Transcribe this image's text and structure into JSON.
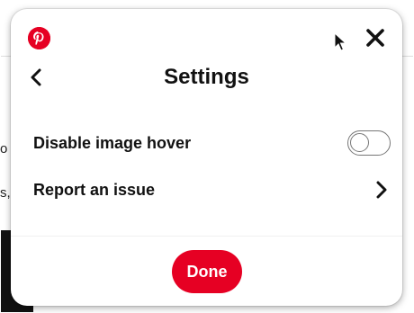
{
  "background": {
    "fragments": [
      "o",
      "s,"
    ]
  },
  "popup": {
    "logo_icon": "pinterest-logo-icon",
    "close_icon": "close-icon",
    "back_icon": "chevron-left-icon",
    "title": "Settings",
    "rows": [
      {
        "label": "Disable image hover",
        "control": "toggle",
        "toggle_on": false
      },
      {
        "label": "Report an issue",
        "control": "chevron-right-icon"
      }
    ],
    "done_label": "Done"
  },
  "colors": {
    "brand_red": "#e60023",
    "text": "#111111",
    "toggle_border": "#767676"
  }
}
